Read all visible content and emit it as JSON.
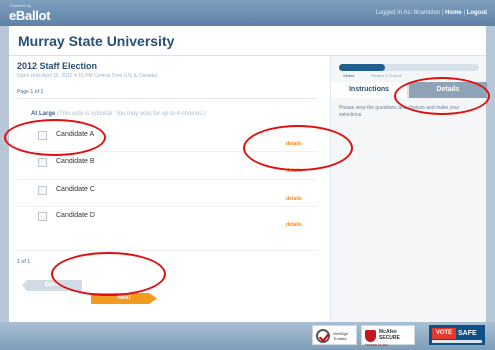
{
  "brand": {
    "powered_by": "Powered by",
    "name": "eBallot"
  },
  "topbar": {
    "logged_in": "Logged In As: bhamidon |",
    "home": "Home",
    "separator": "|",
    "logout": "Logout"
  },
  "organization": "Murray State University",
  "election": {
    "title": "2012 Staff Election",
    "open_until": "Open Until April 26, 2012 4:15 PM Central Time (US & Canada)",
    "page_label": "Page 1 of 1"
  },
  "question": {
    "title": "At Large",
    "note": "(This vote is optional. You may vote for up to 4 choices.)"
  },
  "candidates": [
    {
      "name": "Candidate A",
      "details": "details"
    },
    {
      "name": "Candidate B",
      "details": "details"
    },
    {
      "name": "Candidate C",
      "details": "details"
    },
    {
      "name": "Candidate D",
      "details": "details"
    }
  ],
  "pager": {
    "count": "1 of 1",
    "back_label": "Back",
    "next_label": "Next"
  },
  "steps": {
    "items": [
      "Select",
      "Review & Submit"
    ],
    "progress_fraction": 0.33
  },
  "tabs": {
    "instructions": "Instructions",
    "details": "Details"
  },
  "instructions_text": "Please view the questions and choices and make your selections.",
  "seals": {
    "verisign": {
      "line1": "VeriSign",
      "line2": "Trusted"
    },
    "mcafee": {
      "line1": "McAfee",
      "line2": "SECURE",
      "tested": "TESTED 13-JAN"
    },
    "votesafe": {
      "vote": "VOTE",
      "safe": "SAFE"
    }
  },
  "colors": {
    "accent": "#f39a21",
    "brand": "#2a4f77",
    "annotation": "#e01010"
  }
}
